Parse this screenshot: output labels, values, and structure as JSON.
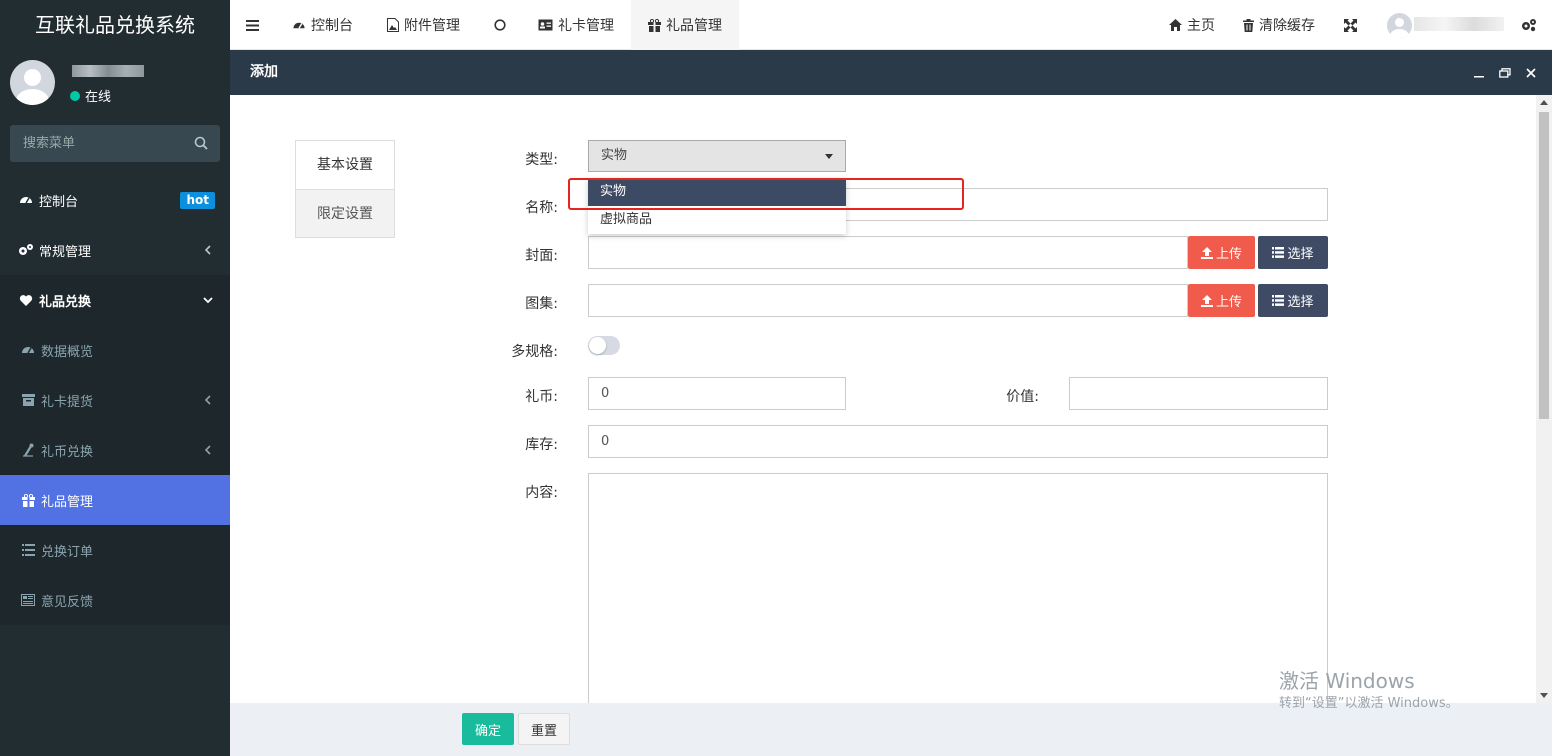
{
  "app": {
    "brand": "互联礼品兑换系统"
  },
  "user": {
    "status": "在线"
  },
  "sidebar": {
    "search_placeholder": "搜索菜单",
    "items": [
      {
        "label": "控制台",
        "badge": "hot"
      },
      {
        "label": "常规管理"
      },
      {
        "label": "礼品兑换"
      },
      {
        "label": "数据概览"
      },
      {
        "label": "礼卡提货"
      },
      {
        "label": "礼币兑换"
      },
      {
        "label": "礼品管理"
      },
      {
        "label": "兑换订单"
      },
      {
        "label": "意见反馈"
      }
    ]
  },
  "topbar": {
    "tabs": [
      {
        "label": "控制台"
      },
      {
        "label": "附件管理"
      },
      {
        "label": ""
      },
      {
        "label": "礼卡管理"
      },
      {
        "label": "礼品管理"
      }
    ],
    "home": "主页",
    "clear_cache": "清除缓存"
  },
  "dialog": {
    "title": "添加",
    "tabs": {
      "basic": "基本设置",
      "limit": "限定设置"
    },
    "labels": {
      "type": "类型:",
      "name": "名称:",
      "cover": "封面:",
      "gallery": "图集:",
      "multi_spec": "多规格:",
      "coins": "礼币:",
      "value": "价值:",
      "stock": "库存:",
      "content": "内容:"
    },
    "type_select": {
      "selected": "实物",
      "options": [
        "实物",
        "虚拟商品"
      ]
    },
    "values": {
      "coins": "0",
      "stock": "0",
      "value": "",
      "name": "",
      "cover": "",
      "gallery": ""
    },
    "buttons": {
      "upload": "上传",
      "choose": "选择",
      "confirm": "确定",
      "reset": "重置"
    }
  },
  "watermark": {
    "title": "激活 Windows",
    "subtitle": "转到“设置”以激活 Windows。"
  },
  "colors": {
    "sidebar_bg": "#222d32",
    "active": "#5271e3",
    "upload": "#f15b4c",
    "choose": "#3f4a65",
    "confirm": "#18bc9c",
    "hot_badge": "#0c8fdc",
    "highlight": "#e5261d"
  }
}
